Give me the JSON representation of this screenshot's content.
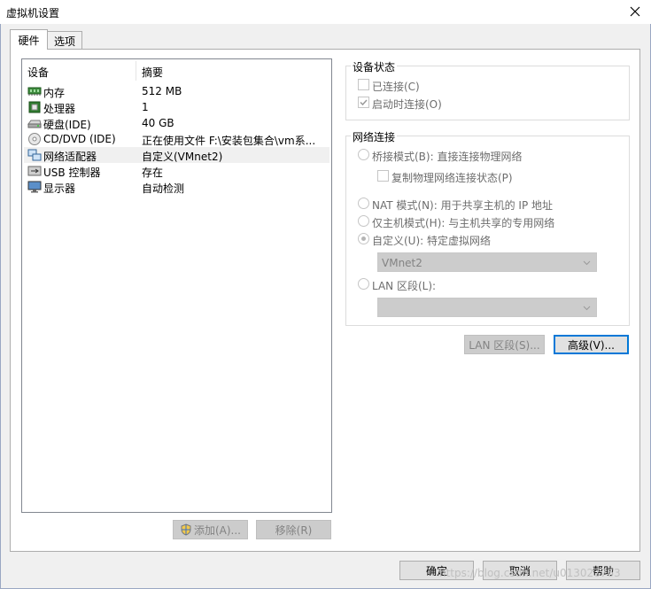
{
  "window": {
    "title": "虚拟机设置"
  },
  "tabs": [
    {
      "label": "硬件"
    },
    {
      "label": "选项"
    }
  ],
  "device_list": {
    "columns": [
      "设备",
      "摘要"
    ],
    "rows": [
      {
        "name": "内存",
        "summary": "512 MB",
        "icon": "memory-icon"
      },
      {
        "name": "处理器",
        "summary": "1",
        "icon": "processor-icon"
      },
      {
        "name": "硬盘(IDE)",
        "summary": "40 GB",
        "icon": "harddisk-icon"
      },
      {
        "name": "CD/DVD (IDE)",
        "summary": "正在使用文件 F:\\安装包集合\\vm系...",
        "icon": "cdrom-icon"
      },
      {
        "name": "网络适配器",
        "summary": "自定义(VMnet2)",
        "icon": "network-adapter-icon"
      },
      {
        "name": "USB 控制器",
        "summary": "存在",
        "icon": "usb-icon"
      },
      {
        "name": "显示器",
        "summary": "自动检测",
        "icon": "display-icon"
      }
    ],
    "add_label": "添加(A)...",
    "remove_label": "移除(R)"
  },
  "device_status": {
    "title": "设备状态",
    "connected_label": "已连接(C)",
    "connect_at_power_on_label": "启动时连接(O)"
  },
  "network_connection": {
    "title": "网络连接",
    "bridged_label": "桥接模式(B): 直接连接物理网络",
    "replicate_label": "复制物理网络连接状态(P)",
    "nat_label": "NAT 模式(N): 用于共享主机的 IP 地址",
    "hostonly_label": "仅主机模式(H): 与主机共享的专用网络",
    "custom_label": "自定义(U): 特定虚拟网络",
    "custom_value": "VMnet2",
    "lan_label": "LAN 区段(L):",
    "lan_value": ""
  },
  "buttons": {
    "lan_segments": "LAN 区段(S)...",
    "advanced": "高级(V)...",
    "ok": "确定",
    "cancel": "取消",
    "help": "帮助"
  },
  "watermark": "https://blog.csdn.net/u013027763"
}
